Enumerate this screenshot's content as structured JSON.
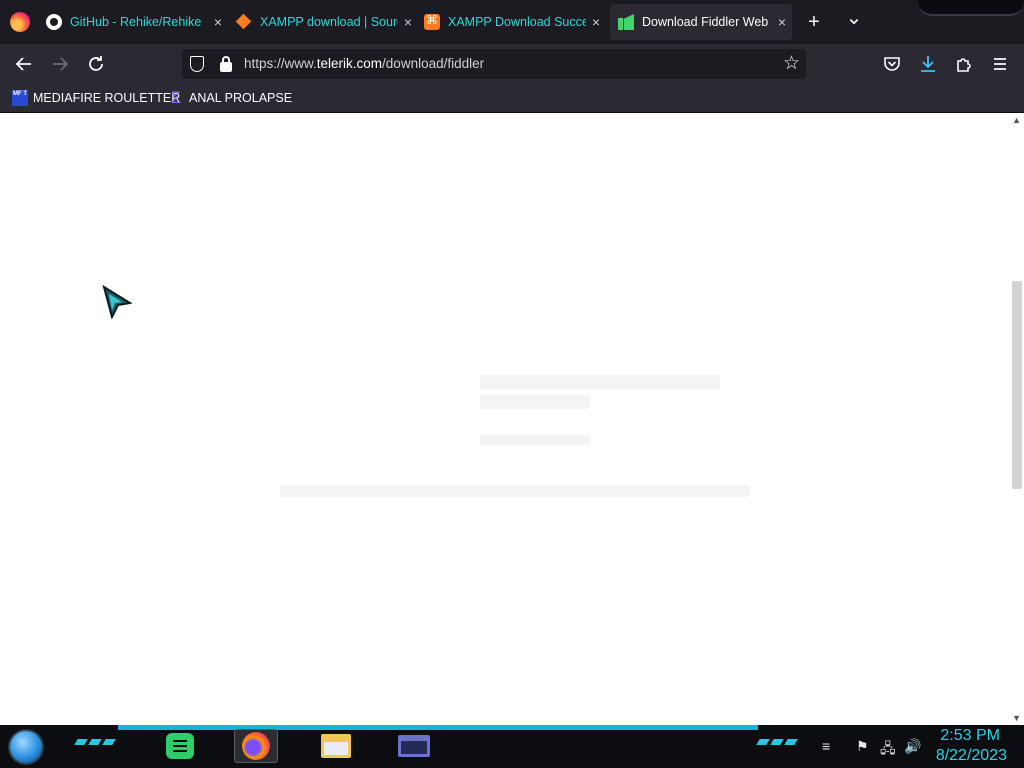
{
  "tabs": [
    {
      "title": "GitHub - Rehike/Rehike",
      "close": "×",
      "active": false
    },
    {
      "title": "XAMPP download | SourceForge",
      "close": "×",
      "active": false
    },
    {
      "title": "XAMPP Download Success",
      "close": "×",
      "active": false
    },
    {
      "title": "Download Fiddler Web Debugger",
      "close": "×",
      "active": true
    }
  ],
  "tabstrip": {
    "new_tab": "+",
    "list_all": "⌄"
  },
  "urlbar": {
    "prefix": "https://www.",
    "domain": "telerik.com",
    "path": "/download/fiddler"
  },
  "bookmarks": [
    {
      "label": "MEDIAFIRE ROULETTER",
      "icon_text": "MF T"
    },
    {
      "label": "ANAL PROLAPSE",
      "icon_text": "Σ"
    }
  ],
  "taskbar": {
    "time": "2:53 PM",
    "date": "8/22/2023"
  },
  "colors": {
    "accent": "#26d3e6",
    "tab_text": "#2bd9d4",
    "toolbar": "#2b2a33",
    "tabstrip": "#1c1b22"
  }
}
